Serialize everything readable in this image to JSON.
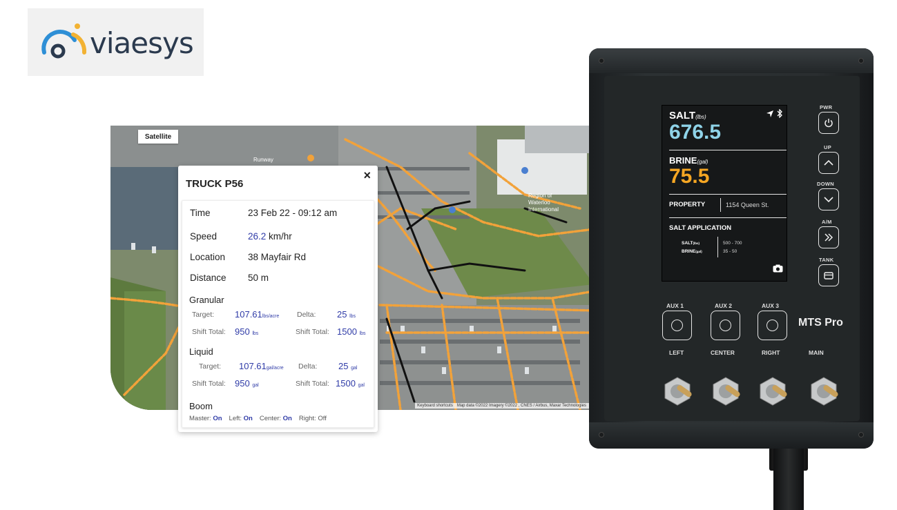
{
  "logo": {
    "text": "viaesys",
    "colors": {
      "ring": "#f2b233",
      "dark": "#2b3a4e",
      "blue": "#2e8fd6"
    }
  },
  "map": {
    "satellite_label": "Satellite",
    "attribution": [
      "Keyboard shortcuts",
      "Map data ©2022 Imagery ©2022 , CNES / Airbus, Maxar Technologies"
    ],
    "route_color": "#f2a23a"
  },
  "popup": {
    "title": "TRUCK P56",
    "close_glyph": "×",
    "fields": [
      {
        "label": "Time",
        "value": "23 Feb 22 - 09:12 am"
      },
      {
        "label": "Speed",
        "value": "26.2",
        "unit": "km/hr"
      },
      {
        "label": "Location",
        "value": "38 Mayfair Rd"
      },
      {
        "label": "Distance",
        "value": "50 m"
      }
    ],
    "granular": {
      "heading": "Granular",
      "target_label": "Target:",
      "target_value": "107.61",
      "target_unit": "lbs/acre",
      "delta_label": "Delta:",
      "delta_value": "25",
      "delta_unit": "lbs",
      "shift_label": "Shift Total:",
      "shift_value": "950",
      "shift_unit": "lbs",
      "shift2_label": "Shift Total:",
      "shift2_value": "1500",
      "shift2_unit": "lbs"
    },
    "liquid": {
      "heading": "Liquid",
      "target_label": "Target:",
      "target_value": "107.61",
      "target_unit": "gal/acre",
      "delta_label": "Delta:",
      "delta_value": "25",
      "delta_unit": "gal",
      "shift_label": "Shift Total:",
      "shift_value": "950",
      "shift_unit": "gal",
      "shift2_label": "Shift Total:",
      "shift2_value": "1500",
      "shift2_unit": "gal"
    },
    "boom": {
      "heading": "Boom",
      "master_label": "Master:",
      "master_value": "On",
      "left_label": "Left:",
      "left_value": "On",
      "center_label": "Center:",
      "center_value": "On",
      "right_label": "Right:",
      "right_value": "Off"
    }
  },
  "device": {
    "screen": {
      "salt_label": "SALT",
      "salt_unit": "(lbs)",
      "salt_value": "676.5",
      "brine_label": "BRINE",
      "brine_unit": "(gal)",
      "brine_value": "75.5",
      "property_label": "PROPERTY",
      "property_value": "1154 Queen St.",
      "application_label": "SALT APPLICATION",
      "app_salt_label": "SALT",
      "app_salt_unit": "(lbs)",
      "app_salt_range": "500 - 700",
      "app_brine_label": "BRINE",
      "app_brine_unit": "(gal)",
      "app_brine_range": "35 - 50",
      "salt_color": "#8fd3e8",
      "brine_color": "#f5a623"
    },
    "side_buttons": [
      {
        "label": "PWR",
        "icon": "power-icon"
      },
      {
        "label": "UP",
        "icon": "chevron-up-icon"
      },
      {
        "label": "DOWN",
        "icon": "chevron-down-icon"
      },
      {
        "label": "A/M",
        "icon": "double-chevron-right-icon"
      },
      {
        "label": "TANK",
        "icon": "tank-icon"
      }
    ],
    "aux_buttons": [
      {
        "top": "AUX 1",
        "bottom": "LEFT"
      },
      {
        "top": "AUX 2",
        "bottom": "CENTER"
      },
      {
        "top": "AUX 3",
        "bottom": "RIGHT"
      }
    ],
    "brand": "MTS Pro",
    "main_label": "MAIN"
  }
}
